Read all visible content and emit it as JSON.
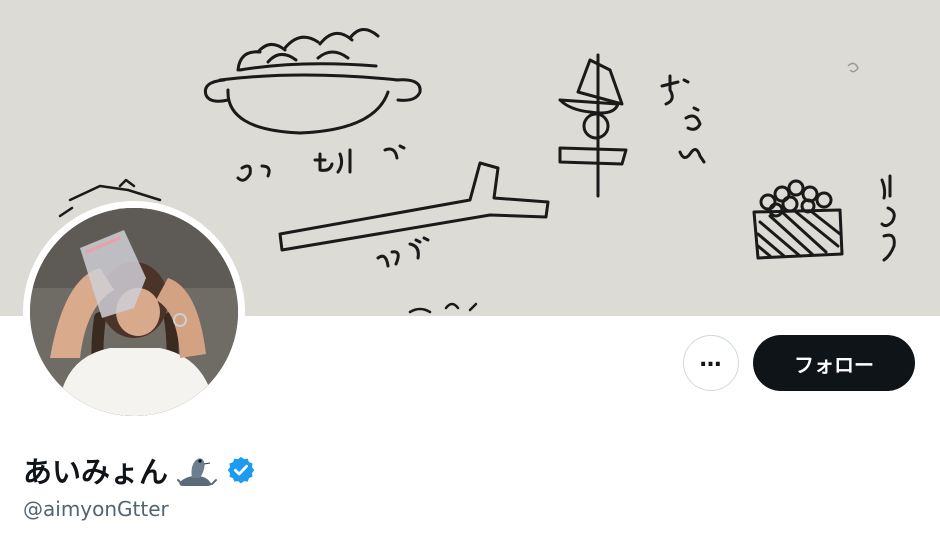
{
  "banner": {
    "doodle_labels": [
      "もつなべ",
      "おでん",
      "ねぎ",
      "いくら"
    ]
  },
  "profile": {
    "display_name": "あいみょん",
    "name_emoji_icon": "seal-icon",
    "verified_icon": "verified-badge-icon",
    "handle": "@aimyonGtter"
  },
  "actions": {
    "more_label": "…",
    "follow_label": "フォロー"
  },
  "colors": {
    "follow_bg": "#0f1419",
    "verified": "#1d9bf0",
    "handle": "#536471",
    "banner_paper": "#dcdbd6"
  }
}
